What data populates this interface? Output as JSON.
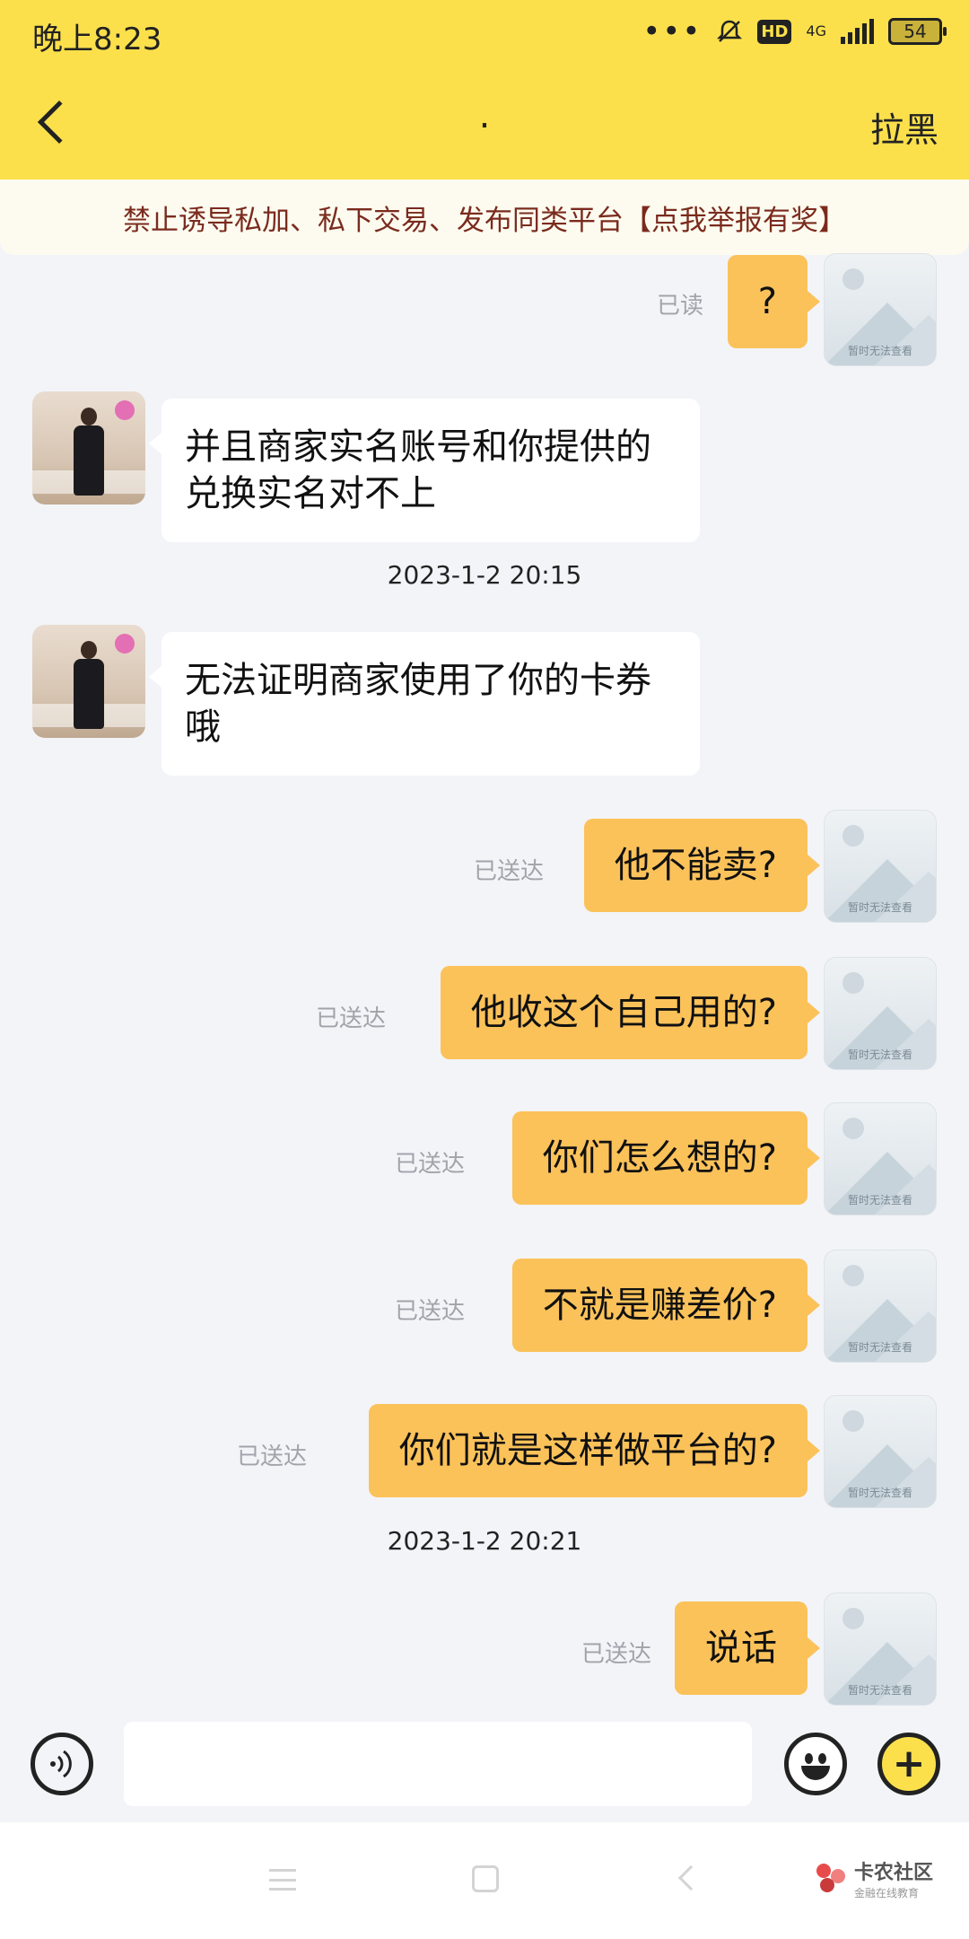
{
  "status_bar": {
    "time": "晚上8:23",
    "hd": "HD",
    "network": "4G",
    "battery": "54"
  },
  "header": {
    "title": ".",
    "block_label": "拉黑"
  },
  "notice": {
    "text": "禁止诱导私加、私下交易、发布同类平台【点我举报有奖】"
  },
  "messages": {
    "m1": {
      "sender": "self",
      "text": "?",
      "status": "已读"
    },
    "m2": {
      "sender": "peer",
      "text": "并且商家实名账号和你提供的兑换实名对不上"
    },
    "t1": "2023-1-2 20:15",
    "m3": {
      "sender": "peer",
      "text": "无法证明商家使用了你的卡券哦"
    },
    "m4": {
      "sender": "self",
      "text": "他不能卖?",
      "status": "已送达"
    },
    "m5": {
      "sender": "self",
      "text": "他收这个自己用的?",
      "status": "已送达"
    },
    "m6": {
      "sender": "self",
      "text": "你们怎么想的?",
      "status": "已送达"
    },
    "m7": {
      "sender": "self",
      "text": "不就是赚差价?",
      "status": "已送达"
    },
    "m8": {
      "sender": "self",
      "text": "你们就是这样做平台的?",
      "status": "已送达"
    },
    "t2": "2023-1-2 20:21",
    "m9": {
      "sender": "self",
      "text": "说话",
      "status": "已送达"
    }
  },
  "self_avatar_caption": "暂时无法查看",
  "input": {
    "placeholder": "",
    "value": ""
  },
  "watermark": {
    "title": "卡农社区",
    "subtitle": "金融在线教育"
  },
  "colors": {
    "header_yellow": "#fbe04c",
    "self_bubble": "#fbc25a",
    "notice_text": "#7a2b1e"
  },
  "icons": [
    "back-arrow-icon",
    "mute-bell-icon",
    "signal-icon",
    "battery-icon",
    "voice-icon",
    "emoji-icon",
    "plus-icon",
    "image-placeholder-icon"
  ]
}
